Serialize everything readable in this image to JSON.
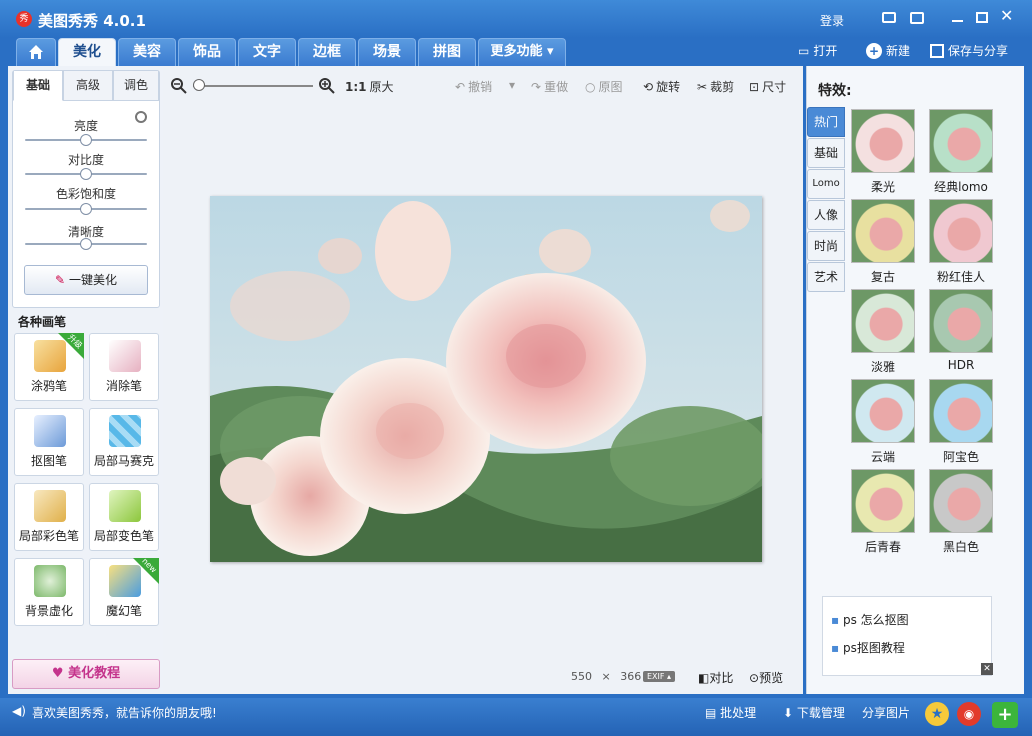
{
  "app": {
    "icon_text": "秀",
    "title": "美图秀秀 4.0.1"
  },
  "titlebar": {
    "login": "登录"
  },
  "tabs": [
    {
      "label": "美化"
    },
    {
      "label": "美容"
    },
    {
      "label": "饰品"
    },
    {
      "label": "文字"
    },
    {
      "label": "边框"
    },
    {
      "label": "场景"
    },
    {
      "label": "拼图"
    },
    {
      "label": "更多功能"
    }
  ],
  "top_actions": {
    "open": "打开",
    "new": "新建",
    "save_share": "保存与分享"
  },
  "left": {
    "subtabs": [
      "基础",
      "高级",
      "调色"
    ],
    "sliders": [
      {
        "label": "亮度",
        "value": 0.5
      },
      {
        "label": "对比度",
        "value": 0.5
      },
      {
        "label": "色彩饱和度",
        "value": 0.5
      },
      {
        "label": "清晰度",
        "value": 0.5
      }
    ],
    "one_key": "一键美化",
    "brushes_title": "各种画笔",
    "brushes": [
      {
        "label": "涂鸦笔",
        "badge": "升级",
        "color": "#e8a43c"
      },
      {
        "label": "消除笔",
        "badge": "",
        "color": "#e6b0c0"
      },
      {
        "label": "抠图笔",
        "badge": "",
        "color": "#6c9ad8"
      },
      {
        "label": "局部马赛克",
        "badge": "",
        "color": "#58b8e8"
      },
      {
        "label": "局部彩色笔",
        "badge": "",
        "color": "#e0b04a"
      },
      {
        "label": "局部变色笔",
        "badge": "",
        "color": "#8cc63c"
      },
      {
        "label": "背景虚化",
        "badge": "",
        "color": "#7cb86a"
      },
      {
        "label": "魔幻笔",
        "badge": "new",
        "color": "#4a9ce0"
      }
    ],
    "tutorial": "美化教程"
  },
  "toolbar": {
    "zoom_ratio": "1:1",
    "original_size": "原大",
    "undo": "撤销",
    "redo": "重做",
    "original": "原图",
    "rotate": "旋转",
    "crop": "裁剪",
    "resize": "尺寸"
  },
  "canvas": {
    "width": "550",
    "times": "×",
    "height": "366",
    "exif": "EXIF",
    "compare": "对比",
    "preview": "预览"
  },
  "effects": {
    "title": "特效:",
    "categories": [
      "热门",
      "基础",
      "Lomo",
      "人像",
      "时尚",
      "艺术"
    ],
    "items": [
      {
        "label": "柔光",
        "tint": "#f4e0e0"
      },
      {
        "label": "经典lomo",
        "tint": "#b8e0c8"
      },
      {
        "label": "复古",
        "tint": "#e8e0a0"
      },
      {
        "label": "粉红佳人",
        "tint": "#f0c8d0"
      },
      {
        "label": "淡雅",
        "tint": "#d8e8d8"
      },
      {
        "label": "HDR",
        "tint": "#a8c8b0"
      },
      {
        "label": "云端",
        "tint": "#d0e8f0"
      },
      {
        "label": "阿宝色",
        "tint": "#a8d8f0"
      },
      {
        "label": "后青春",
        "tint": "#e8e8b0"
      },
      {
        "label": "黑白色",
        "tint": "#c8c8c8"
      }
    ]
  },
  "ads": [
    "ps 怎么抠图",
    "ps抠图教程"
  ],
  "status": {
    "message": "喜欢美图秀秀，就告诉你的朋友哦!",
    "batch": "批处理",
    "download": "下载管理",
    "share_image": "分享图片"
  }
}
